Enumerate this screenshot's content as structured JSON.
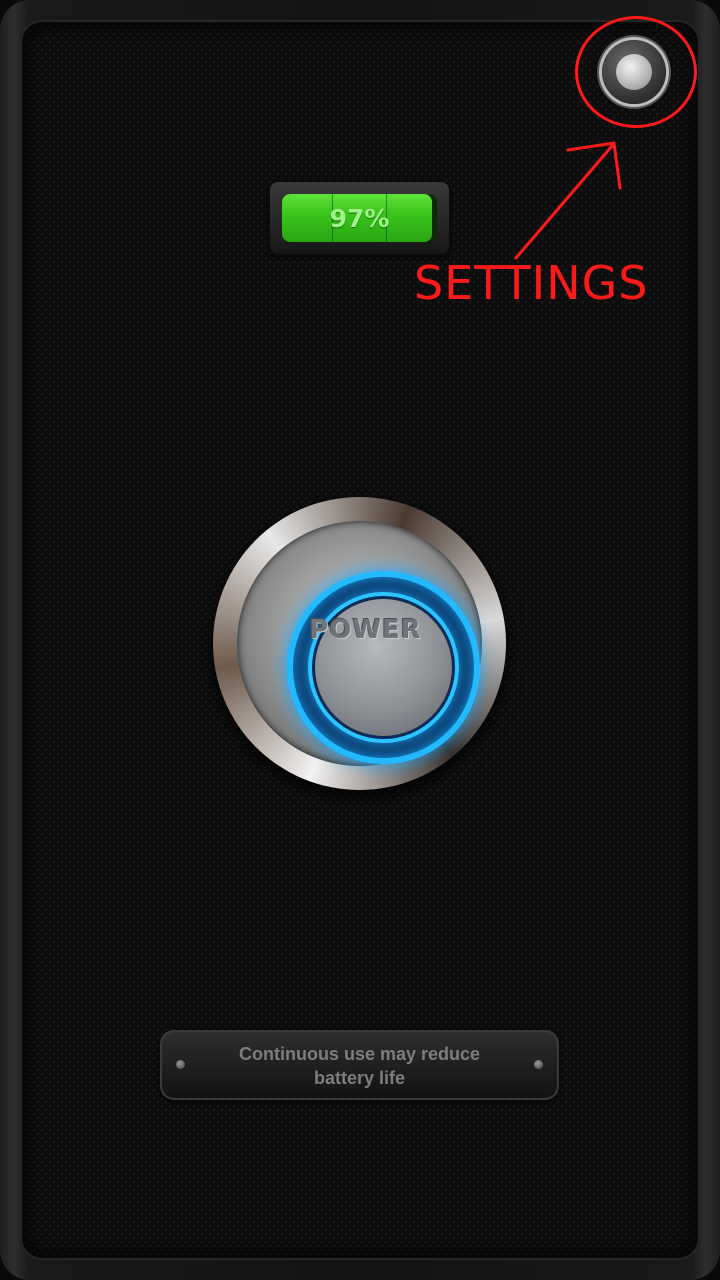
{
  "battery": {
    "percent_label": "97%",
    "level_percent": 97,
    "color": "#38c21a"
  },
  "power_button": {
    "label": "POWER",
    "glow_color": "#23b9ff"
  },
  "settings": {
    "icon": "settings-knob-icon",
    "annotation_label": "SETTINGS",
    "annotation_color": "#ff1a1a"
  },
  "warning": {
    "line1": "Continuous use may reduce",
    "line2": "battery life"
  }
}
